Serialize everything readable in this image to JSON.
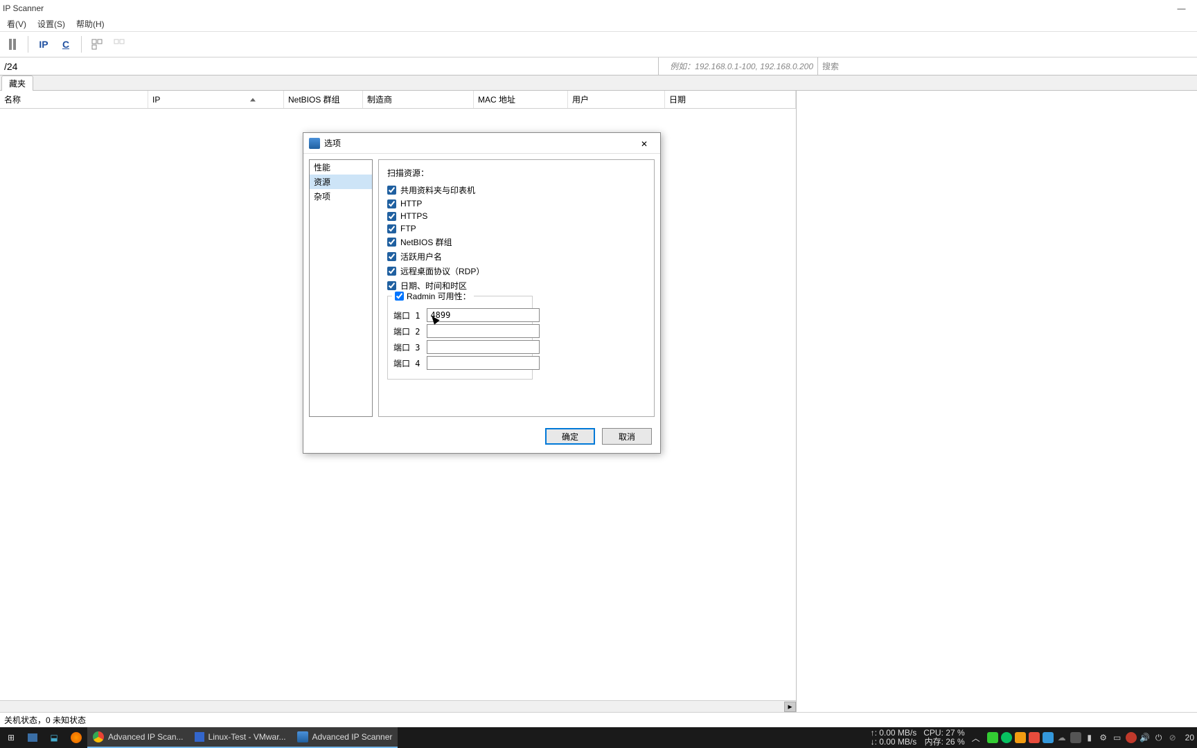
{
  "window": {
    "title": "IP Scanner"
  },
  "menu": {
    "view": "看(V)",
    "settings": "设置(S)",
    "help": "帮助(H)"
  },
  "toolbar": {
    "ip_label": "IP",
    "c_label": "C"
  },
  "range": {
    "value": "/24",
    "hint": "例如：192.168.0.1-100, 192.168.0.200",
    "search_placeholder": "搜索"
  },
  "tabs": {
    "favorites": "藏夹"
  },
  "columns": {
    "name": "名称",
    "ip": "IP",
    "netbios": "NetBIOS 群组",
    "manufacturer": "制造商",
    "mac": "MAC 地址",
    "user": "用户",
    "date": "日期"
  },
  "status": {
    "text": "关机状态，0 未知状态"
  },
  "dialog": {
    "title": "选项",
    "nav": [
      "性能",
      "资源",
      "杂项"
    ],
    "nav_selected": 1,
    "heading": "扫描资源：",
    "checks": [
      {
        "label": "共用资料夹与印表机",
        "checked": true
      },
      {
        "label": "HTTP",
        "checked": true
      },
      {
        "label": "HTTPS",
        "checked": true
      },
      {
        "label": "FTP",
        "checked": true
      },
      {
        "label": "NetBIOS 群组",
        "checked": true
      },
      {
        "label": "活跃用户名",
        "checked": true
      },
      {
        "label": "远程桌面协议（RDP）",
        "checked": true
      },
      {
        "label": "日期、时间和时区",
        "checked": true
      }
    ],
    "radmin": {
      "label": "Radmin 可用性：",
      "checked": true,
      "port1_label": "端口 1",
      "port2_label": "端口 2",
      "port3_label": "端口 3",
      "port4_label": "端口 4",
      "port1_value": "4899",
      "port2_value": "",
      "port3_value": "",
      "port4_value": ""
    },
    "ok": "确定",
    "cancel": "取消"
  },
  "taskbar": {
    "items": [
      {
        "label": "Advanced IP Scan...",
        "icon": "chrome"
      },
      {
        "label": "Linux-Test - VMwar...",
        "icon": "vmware"
      },
      {
        "label": "Advanced IP Scanner",
        "icon": "ipscanner",
        "active": true
      }
    ],
    "net_up": "↑: 0.00 MB/s",
    "net_down": "↓: 0.00 MB/s",
    "cpu": "CPU: 27 %",
    "mem": "内存: 26 %",
    "clock": "20"
  }
}
